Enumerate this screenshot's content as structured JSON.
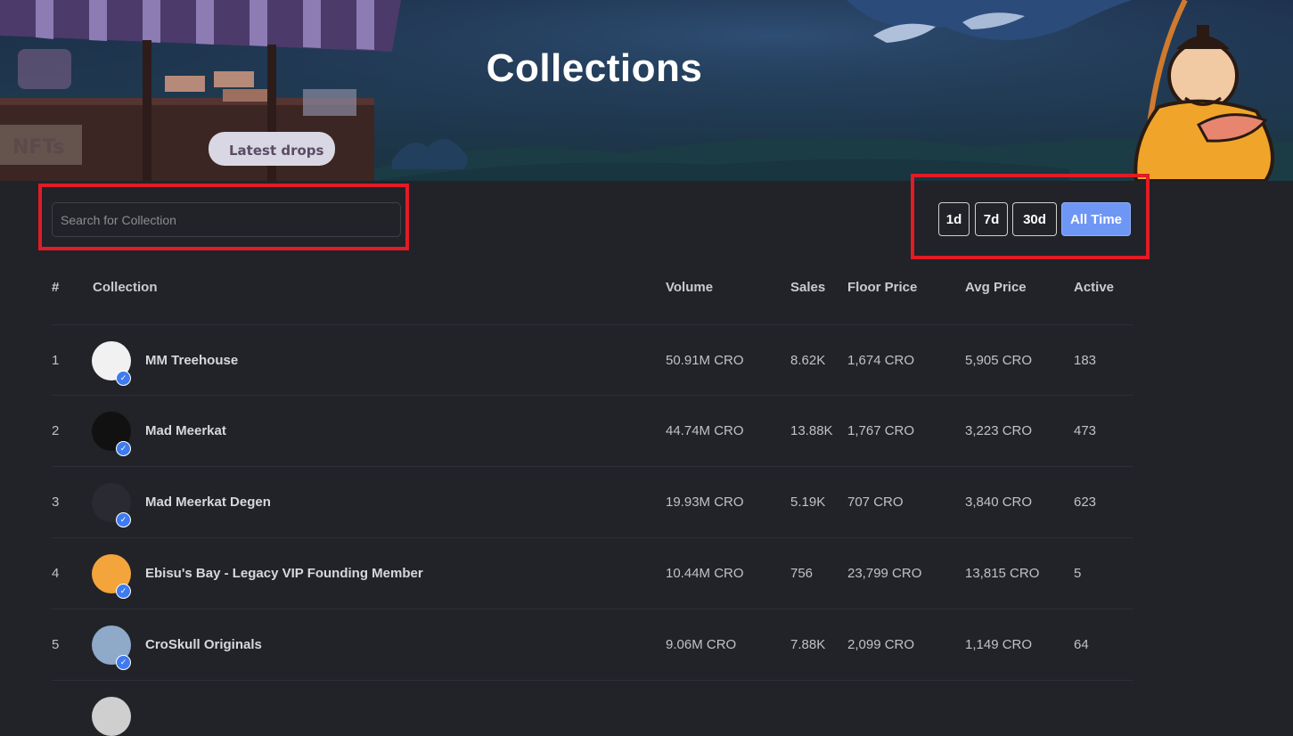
{
  "hero": {
    "title": "Collections",
    "sign_nfts": "NFTs",
    "sign_latest": "Latest drops"
  },
  "search": {
    "placeholder": "Search for Collection",
    "value": ""
  },
  "periods": [
    {
      "label": "1d",
      "active": false
    },
    {
      "label": "7d",
      "active": false
    },
    {
      "label": "30d",
      "active": false
    },
    {
      "label": "All Time",
      "active": true
    }
  ],
  "columns": [
    "#",
    "Collection",
    "Volume",
    "Sales",
    "Floor Price",
    "Avg Price",
    "Active"
  ],
  "rows": [
    {
      "rank": "1",
      "name": "MM Treehouse",
      "volume": "50.91M CRO",
      "sales": "8.62K",
      "floor": "1,674 CRO",
      "avg": "5,905 CRO",
      "active": "183",
      "avatar_color": "#f1f1f1",
      "verified": true
    },
    {
      "rank": "2",
      "name": "Mad Meerkat",
      "volume": "44.74M CRO",
      "sales": "13.88K",
      "floor": "1,767 CRO",
      "avg": "3,223 CRO",
      "active": "473",
      "avatar_color": "#111111",
      "verified": true
    },
    {
      "rank": "3",
      "name": "Mad Meerkat Degen",
      "volume": "19.93M CRO",
      "sales": "5.19K",
      "floor": "707 CRO",
      "avg": "3,840 CRO",
      "active": "623",
      "avatar_color": "#2a2a33",
      "verified": true
    },
    {
      "rank": "4",
      "name": "Ebisu's Bay - Legacy VIP Founding Member",
      "volume": "10.44M CRO",
      "sales": "756",
      "floor": "23,799 CRO",
      "avg": "13,815 CRO",
      "active": "5",
      "avatar_color": "#f3a43a",
      "verified": true
    },
    {
      "rank": "5",
      "name": "CroSkull Originals",
      "volume": "9.06M CRO",
      "sales": "7.88K",
      "floor": "2,099 CRO",
      "avg": "1,149 CRO",
      "active": "64",
      "avatar_color": "#8fa9c9",
      "verified": true
    }
  ],
  "icons": {
    "verified": "check-badge-icon"
  },
  "colors": {
    "accent": "#6e96f5",
    "highlight": "#e21b25",
    "verified": "#3f7bf0"
  }
}
